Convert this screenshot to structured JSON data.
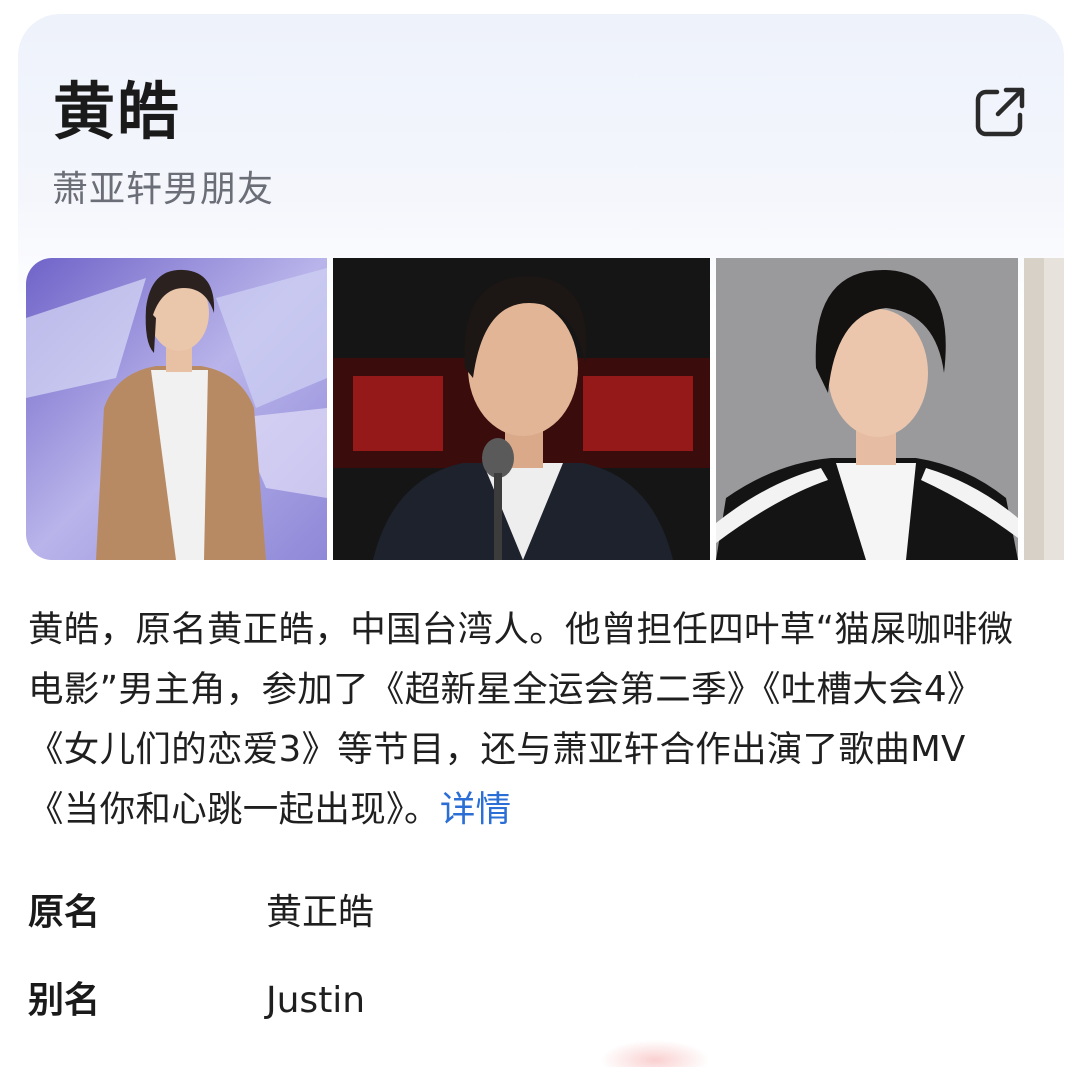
{
  "entity": {
    "title": "黄皓",
    "subtitle": "萧亚轩男朋友"
  },
  "icons": {
    "share": "share-external-icon"
  },
  "gallery": {
    "photos": [
      {
        "name": "photo-1"
      },
      {
        "name": "photo-2"
      },
      {
        "name": "photo-3"
      },
      {
        "name": "photo-4-partial"
      }
    ]
  },
  "description": {
    "text": "黄皓，原名黄正皓，中国台湾人。他曾担任四叶草“猫屎咖啡微电影”男主角，参加了《超新星全运会第二季》《吐槽大会4》《女儿们的恋爱3》等节目，还与萧亚轩合作出演了歌曲MV《当你和心跳一起出现》。",
    "more_label": "详情"
  },
  "info": {
    "rows": [
      {
        "label": "原名",
        "value": "黄正皓"
      },
      {
        "label": "别名",
        "value": "Justin"
      }
    ]
  },
  "colors": {
    "link": "#2b6fd6",
    "subtitle": "#6b6e76"
  }
}
